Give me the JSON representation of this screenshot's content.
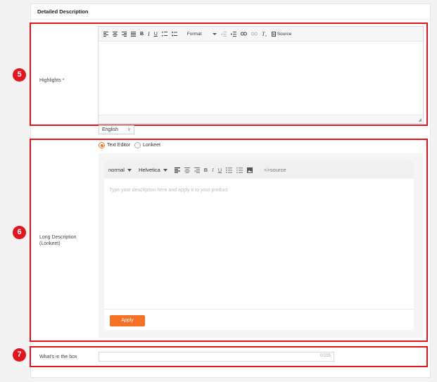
{
  "section": {
    "title": "Detailed Description"
  },
  "badges": {
    "highlights": "5",
    "long_description": "6",
    "whats_in_box": "7"
  },
  "highlights": {
    "label": "Highlights",
    "required_mark": "*",
    "toolbar": {
      "bold": "B",
      "italic": "I",
      "underline": "U",
      "format_label": "Format",
      "source_label": "Source"
    },
    "language": {
      "selected": "English"
    }
  },
  "long_description": {
    "label": "Long Description (Lorikeet)",
    "radio_text_editor": "Text Editor",
    "radio_lorikeet": "Lorikeet",
    "selected_mode": "Text Editor",
    "toolbar": {
      "size_value": "normal",
      "font_value": "Helvetica",
      "bold": "B",
      "italic": "I",
      "underline": "U",
      "source_label": "<>source"
    },
    "placeholder": "Type your description here and apply it to your product",
    "apply_label": "Apply"
  },
  "whats_in_box": {
    "label": "What's in the box",
    "value": "",
    "counter": "0/255"
  },
  "colors": {
    "accent": "#f57224",
    "highlight_red": "#e3141b"
  }
}
